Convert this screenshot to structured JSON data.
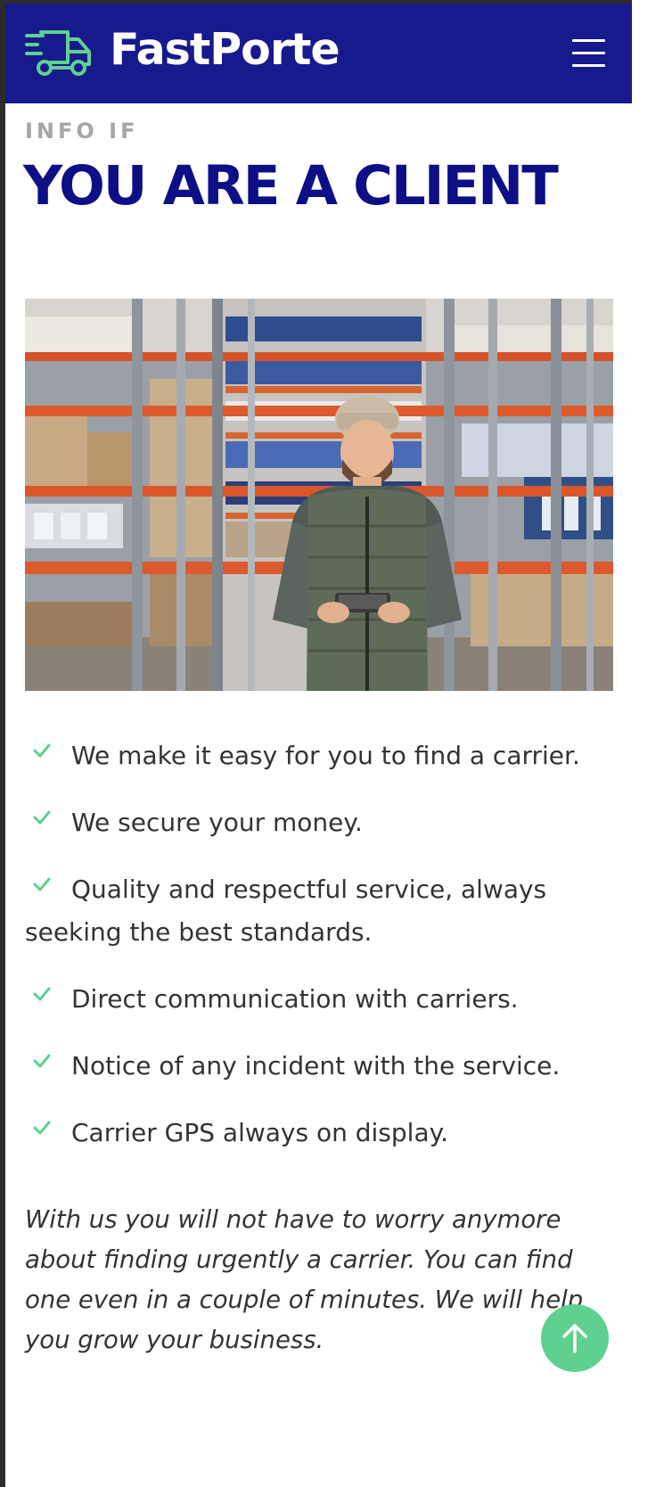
{
  "header": {
    "brand": "FastPorte",
    "logo_icon": "delivery-truck-icon",
    "menu_icon": "hamburger-menu-icon"
  },
  "section": {
    "eyebrow": "INFO IF",
    "title": "YOU ARE A CLIENT"
  },
  "hero_image": {
    "alt": "Warehouse worker in a beanie and green vest holding a tablet"
  },
  "features": {
    "icon": "check-icon",
    "items": [
      "We make it easy for you to find a carrier.",
      "We secure your money.",
      "Quality and respectful service, always seeking the best standards.",
      "Direct communication with carriers.",
      "Notice of any incident with the service.",
      "Carrier GPS always on display."
    ]
  },
  "closing_text": "With us you will not have to worry anymore about finding urgently a carrier. You can find one even in a couple of minutes. We will help you grow your business.",
  "scroll_top": {
    "icon": "arrow-up-icon"
  },
  "colors": {
    "header_bg": "#161a8c",
    "title": "#0c0f86",
    "accent_green": "#5fd08f",
    "eyebrow": "#a6a6a6",
    "body_text": "#333333"
  }
}
